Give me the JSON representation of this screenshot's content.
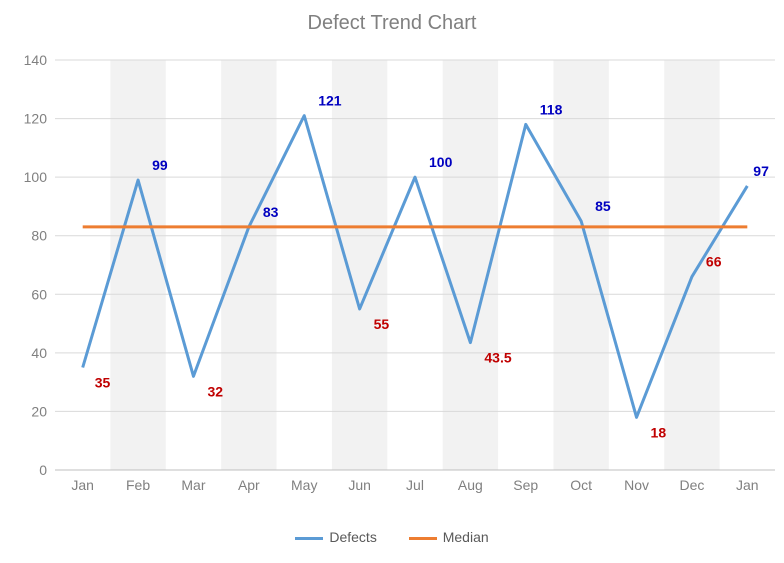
{
  "title": "Defect Trend Chart",
  "legend": {
    "defects": "Defects",
    "median": "Median"
  },
  "chart_data": {
    "type": "line",
    "categories": [
      "Jan",
      "Feb",
      "Mar",
      "Apr",
      "May",
      "Jun",
      "Jul",
      "Aug",
      "Sep",
      "Oct",
      "Nov",
      "Dec",
      "Jan"
    ],
    "series": [
      {
        "name": "Defects",
        "values": [
          35,
          99,
          32,
          83,
          121,
          55,
          100,
          43.5,
          118,
          85,
          18,
          66,
          97
        ],
        "color": "#5B9BD5"
      },
      {
        "name": "Median",
        "values": [
          83,
          83,
          83,
          83,
          83,
          83,
          83,
          83,
          83,
          83,
          83,
          83,
          83
        ],
        "color": "#ED7D31"
      }
    ],
    "ylim": [
      0,
      140
    ],
    "yticks": [
      0,
      20,
      40,
      60,
      80,
      100,
      120,
      140
    ],
    "data_labels": [
      {
        "i": 0,
        "text": "35",
        "color": "#C00000",
        "pos": "below"
      },
      {
        "i": 1,
        "text": "99",
        "color": "#0000C0",
        "pos": "above"
      },
      {
        "i": 2,
        "text": "32",
        "color": "#C00000",
        "pos": "below"
      },
      {
        "i": 3,
        "text": "83",
        "color": "#0000C0",
        "pos": "above"
      },
      {
        "i": 4,
        "text": "121",
        "color": "#0000C0",
        "pos": "above"
      },
      {
        "i": 5,
        "text": "55",
        "color": "#C00000",
        "pos": "below"
      },
      {
        "i": 6,
        "text": "100",
        "color": "#0000C0",
        "pos": "above"
      },
      {
        "i": 7,
        "text": "43.5",
        "color": "#C00000",
        "pos": "below"
      },
      {
        "i": 8,
        "text": "118",
        "color": "#0000C0",
        "pos": "above"
      },
      {
        "i": 9,
        "text": "85",
        "color": "#0000C0",
        "pos": "above"
      },
      {
        "i": 10,
        "text": "18",
        "color": "#C00000",
        "pos": "below"
      },
      {
        "i": 11,
        "text": "66",
        "color": "#C00000",
        "pos": "above"
      },
      {
        "i": 12,
        "text": "97",
        "color": "#0000C0",
        "pos": "above"
      }
    ],
    "xlabel": "",
    "ylabel": ""
  },
  "colors": {
    "gridline": "#D9D9D9",
    "band": "#F2F2F2",
    "axis_text": "#808080",
    "title": "#808080"
  }
}
